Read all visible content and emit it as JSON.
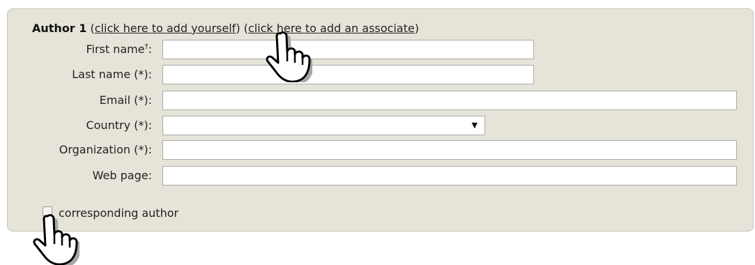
{
  "author_block": {
    "title": "Author 1",
    "open_paren_1": "(",
    "add_yourself_link": "click here to add yourself",
    "close_paren_1": ")",
    "open_paren_2": "(",
    "add_associate_link": "click here to add an associate",
    "close_paren_2": ")"
  },
  "fields": {
    "first_name": {
      "label": "First name",
      "mark": "†",
      "suffix": ":",
      "value": ""
    },
    "last_name": {
      "label": "Last name (*):",
      "value": ""
    },
    "email": {
      "label": "Email (*):",
      "value": ""
    },
    "country": {
      "label": "Country (*):",
      "selected": ""
    },
    "organization": {
      "label": "Organization (*):",
      "value": ""
    },
    "web_page": {
      "label": "Web page:",
      "value": ""
    }
  },
  "corresponding": {
    "label": "corresponding author",
    "checked": false
  },
  "icons": {
    "cursor": "hand-pointer-icon",
    "dropdown": "triangle-down-icon"
  },
  "colors": {
    "panel_bg": "#e6e4d8",
    "panel_border": "#c8c6bb"
  }
}
